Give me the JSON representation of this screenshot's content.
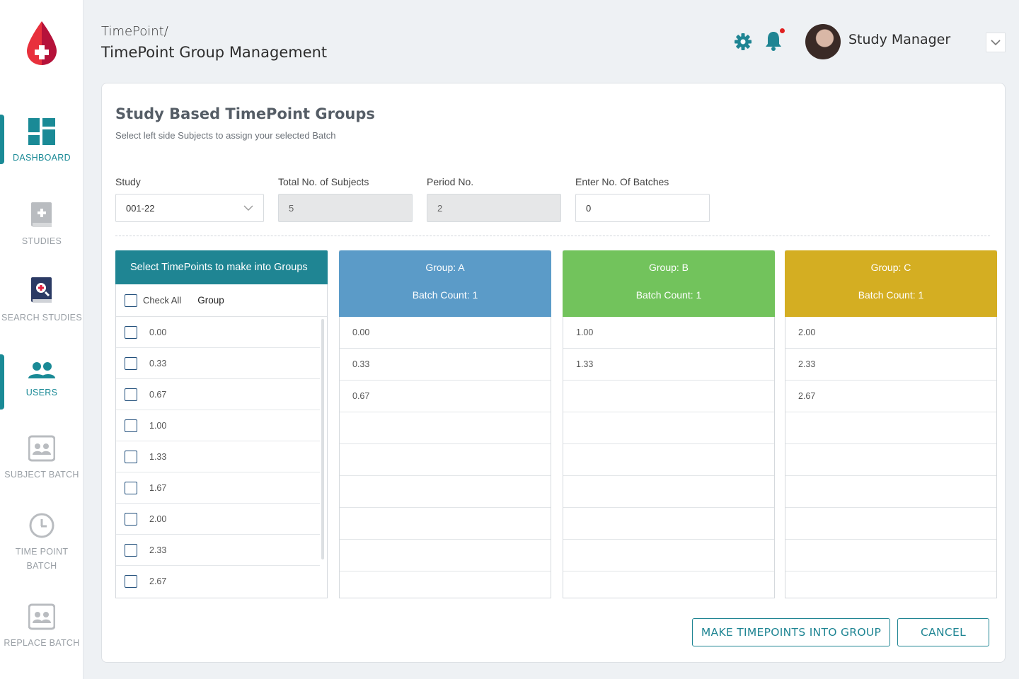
{
  "sidebar": {
    "items": [
      {
        "label": "DASHBOARD",
        "icon": "dashboard-icon",
        "active": true
      },
      {
        "label": "STUDIES",
        "icon": "book-icon",
        "active": false
      },
      {
        "label": "SEARCH STUDIES",
        "icon": "search-book-icon",
        "active": false
      },
      {
        "label": "USERS",
        "icon": "users-icon",
        "active": true
      },
      {
        "label": "SUBJECT BATCH",
        "icon": "id-card-icon",
        "active": false
      },
      {
        "label": "TIME POINT",
        "label2": "BATCH",
        "icon": "clock-icon",
        "active": false
      },
      {
        "label": "REPLACE BATCH",
        "icon": "id-card-icon",
        "active": false
      }
    ]
  },
  "header": {
    "breadcrumb": "TimePoint/",
    "title": "TimePoint Group Management",
    "user_name": "Study Manager"
  },
  "card": {
    "title": "Study Based TimePoint Groups",
    "subtitle": "Select left side Subjects to assign your selected Batch",
    "fields": {
      "study_label": "Study",
      "study_value": "001-22",
      "subjects_label": "Total No. of Subjects",
      "subjects_value": "5",
      "period_label": "Period No.",
      "period_value": "2",
      "batches_label": "Enter No. Of Batches",
      "batches_value": "0"
    },
    "selector": {
      "header": "Select TimePoints to make into Groups",
      "check_all": "Check All",
      "group_col": "Group",
      "timepoints": [
        "0.00",
        "0.33",
        "0.67",
        "1.00",
        "1.33",
        "1.67",
        "2.00",
        "2.33",
        "2.67"
      ]
    },
    "groups": [
      {
        "name": "Group: A",
        "batch_count": "Batch Count: 1",
        "color": "#5b9bc8",
        "items": [
          "0.00",
          "0.33",
          "0.67"
        ]
      },
      {
        "name": "Group: B",
        "batch_count": "Batch Count: 1",
        "color": "#72c35c",
        "items": [
          "1.00",
          "1.33"
        ]
      },
      {
        "name": "Group: C",
        "batch_count": "Batch Count: 1",
        "color": "#d4ae22",
        "items": [
          "2.00",
          "2.33",
          "2.67"
        ]
      }
    ],
    "buttons": {
      "make_group": "MAKE TIMEPOINTS INTO GROUP",
      "cancel": "CANCEL"
    }
  },
  "colors": {
    "accent": "#1f8593",
    "active_nav": "#1a8a96"
  }
}
